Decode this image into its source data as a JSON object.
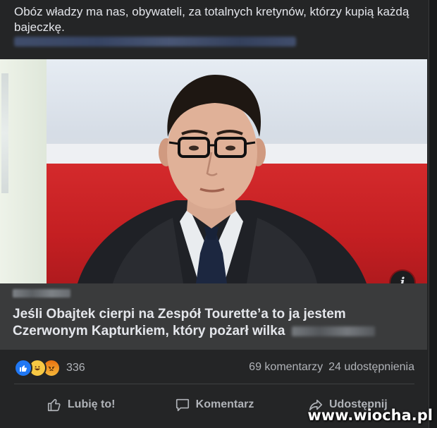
{
  "post": {
    "caption": "Obóz władzy ma nas, obywateli, za totalnych kretynów, którzy kupią każdą bajeczkę."
  },
  "link_preview": {
    "title": "Jeśli Obajtek cierpi na Zespół Tourette’a to ja jestem Czerwonym Kapturkiem, który pożarł wilka",
    "info_icon": "i"
  },
  "reactions": {
    "icons": [
      "like-icon",
      "haha-icon",
      "angry-icon"
    ],
    "count": "336"
  },
  "stats": {
    "comments": "69 komentarzy",
    "shares": "24 udostępnienia"
  },
  "actions": {
    "like": "Lubię to!",
    "comment": "Komentarz",
    "share": "Udostępnij"
  },
  "watermark": "www.wiocha.pl",
  "colors": {
    "background": "#242526",
    "text": "#e4e6eb",
    "secondary_text": "#b0b3b8",
    "preview_bg": "#3a3b3c",
    "like_blue": "#2078f4"
  }
}
